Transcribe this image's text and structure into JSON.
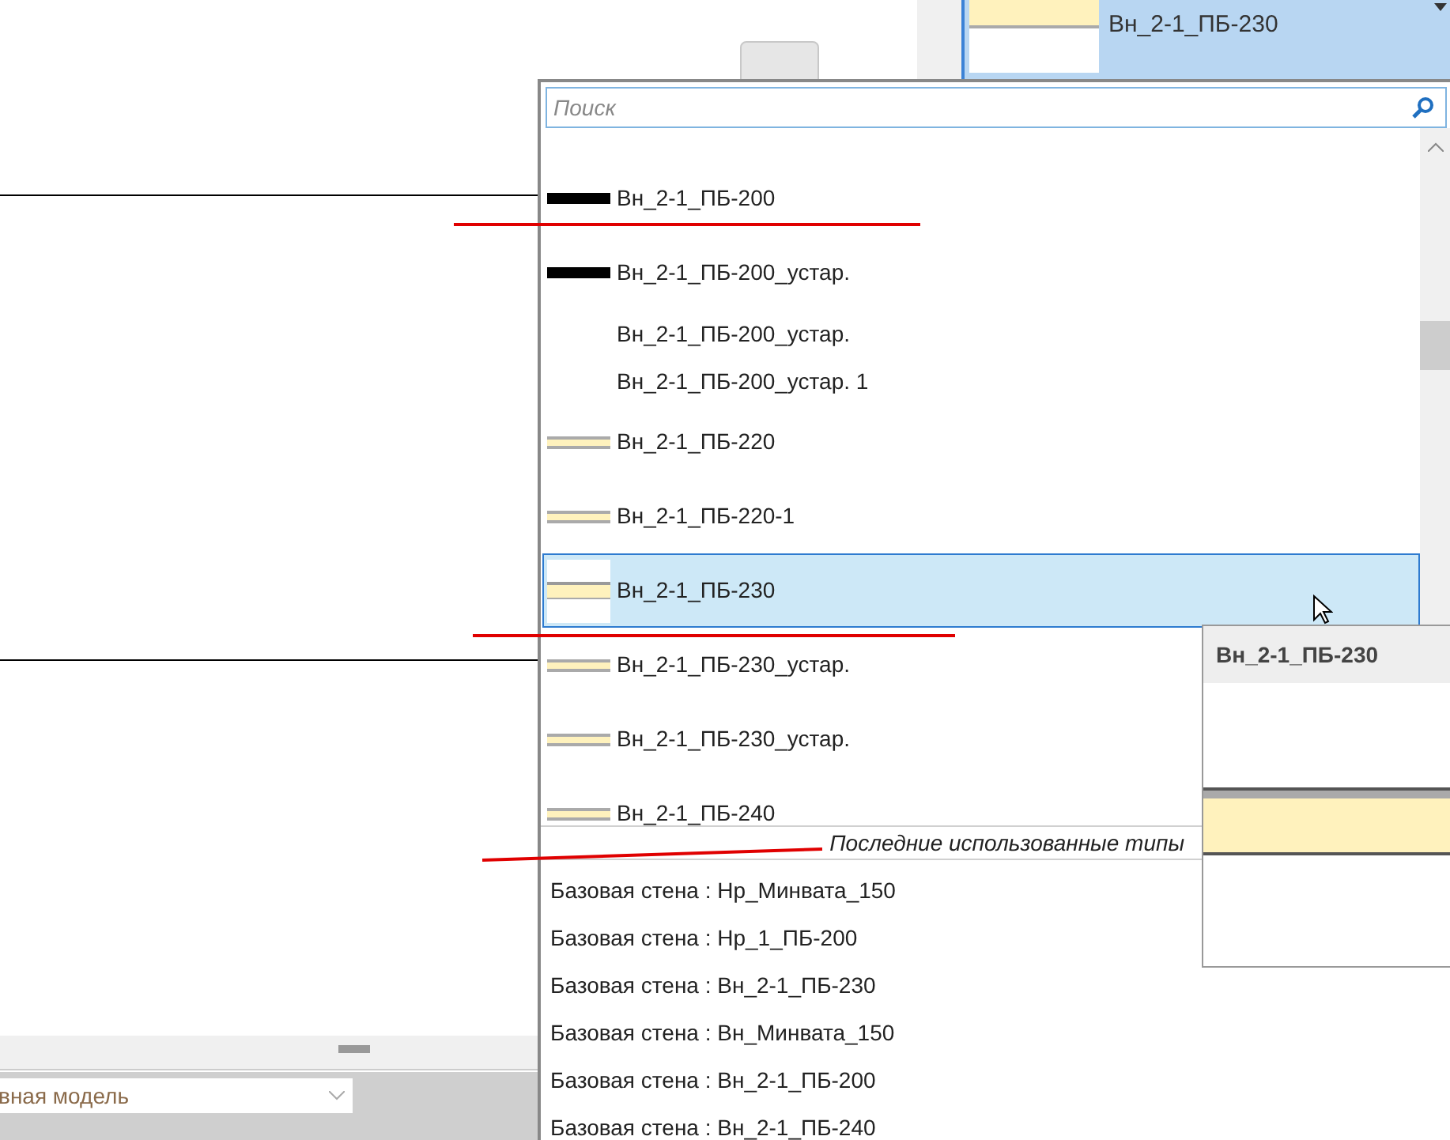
{
  "properties": {
    "type": "Вн_2-1_ПБ-230"
  },
  "view_selector": {
    "value": "вная модель"
  },
  "type_dropdown": {
    "search": {
      "placeholder": "Поиск"
    },
    "types": [
      {
        "label": "Вн_2-1_ПБ-200",
        "kind": "solid",
        "selected": false
      },
      {
        "label": "Вн_2-1_ПБ-200_устар.",
        "kind": "solid",
        "selected": false
      },
      {
        "label": "Вн_2-1_ПБ-200_устар.",
        "kind": "none",
        "selected": false
      },
      {
        "label": "Вн_2-1_ПБ-200_устар. 1",
        "kind": "none",
        "selected": false
      },
      {
        "label": "Вн_2-1_ПБ-220",
        "kind": "layered",
        "selected": false
      },
      {
        "label": "Вн_2-1_ПБ-220-1",
        "kind": "layered",
        "selected": false
      },
      {
        "label": "Вн_2-1_ПБ-230",
        "kind": "layered",
        "selected": true
      },
      {
        "label": "Вн_2-1_ПБ-230_устар.",
        "kind": "layered",
        "selected": false
      },
      {
        "label": "Вн_2-1_ПБ-230_устар.",
        "kind": "layered",
        "selected": false
      },
      {
        "label": "Вн_2-1_ПБ-240",
        "kind": "layered",
        "selected": false
      }
    ],
    "recent_header": "Последние использованные типы",
    "recent": [
      "Базовая стена : Нр_Минвата_150",
      "Базовая стена : Нр_1_ПБ-200",
      "Базовая стена : Вн_2-1_ПБ-230",
      "Базовая стена : Вн_Минвата_150",
      "Базовая стена : Вн_2-1_ПБ-200",
      "Базовая стена : Вн_2-1_ПБ-240"
    ]
  },
  "tooltip": {
    "title": "Вн_2-1_ПБ-230"
  }
}
